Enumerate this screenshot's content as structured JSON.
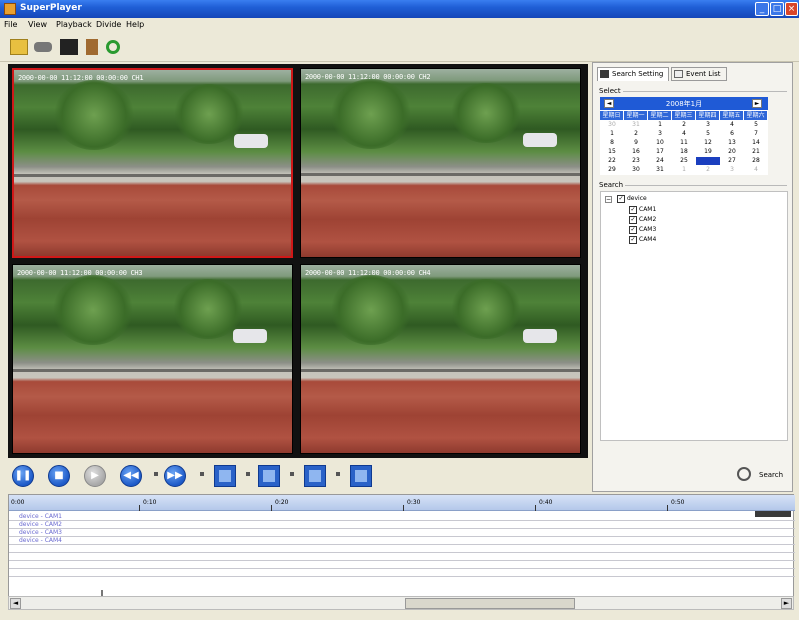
{
  "window": {
    "title": "SuperPlayer",
    "min": "_",
    "max": "□",
    "close": "×"
  },
  "menu": [
    "File",
    "View",
    "Playback",
    "Divide",
    "Help"
  ],
  "toolbar": [
    {
      "name": "open-folder-icon",
      "color": "#e8c040"
    },
    {
      "name": "drive-icon",
      "color": "#777777"
    },
    {
      "name": "monitor-icon",
      "color": "#222222"
    },
    {
      "name": "capture-icon",
      "color": "#a06a30"
    },
    {
      "name": "refresh-icon",
      "color": "#2a9a30"
    }
  ],
  "cameras": [
    {
      "osd": "2000-00-00 11:12:00 00:00:00 CH1"
    },
    {
      "osd": "2000-00-00 11:12:00 00:00:00 CH2"
    },
    {
      "osd": "2000-00-00 11:12:00 00:00:00 CH3"
    },
    {
      "osd": "2000-00-00 11:12:00 00:00:00 CH4"
    }
  ],
  "right_panel": {
    "tab_search": "Search Setting",
    "tab_event": "Event List",
    "select_label": "Select",
    "search_label": "Search",
    "search_button": "Search",
    "calendar": {
      "month": "2008年1月",
      "prev": "◄",
      "next": "►",
      "dow": [
        "星期日",
        "星期一",
        "星期二",
        "星期三",
        "星期四",
        "星期五",
        "星期六"
      ],
      "weeks": [
        [
          "30",
          "31",
          "1",
          "2",
          "3",
          "4",
          "5"
        ],
        [
          "1",
          "2",
          "3",
          "4",
          "5",
          "6",
          "7"
        ],
        [
          "8",
          "9",
          "10",
          "11",
          "12",
          "13",
          "14"
        ],
        [
          "15",
          "16",
          "17",
          "18",
          "19",
          "20",
          "21"
        ],
        [
          "22",
          "23",
          "24",
          "25",
          "26",
          "27",
          "28"
        ],
        [
          "29",
          "30",
          "31",
          "1",
          "2",
          "3",
          "4"
        ]
      ],
      "selected_day": "26"
    },
    "tree": {
      "root": "device",
      "children": [
        "CAM1",
        "CAM2",
        "CAM3",
        "CAM4"
      ]
    }
  },
  "timeline": {
    "ticks": [
      "0:00",
      "0:10",
      "0:20",
      "0:30",
      "0:40",
      "0:50"
    ],
    "rows": [
      "device - CAM1",
      "device - CAM2",
      "device - CAM3",
      "device - CAM4"
    ]
  },
  "colors": {
    "title_bar": "#1f5fd6",
    "active_border": "#d01818",
    "accent": "#1f5ad6"
  }
}
